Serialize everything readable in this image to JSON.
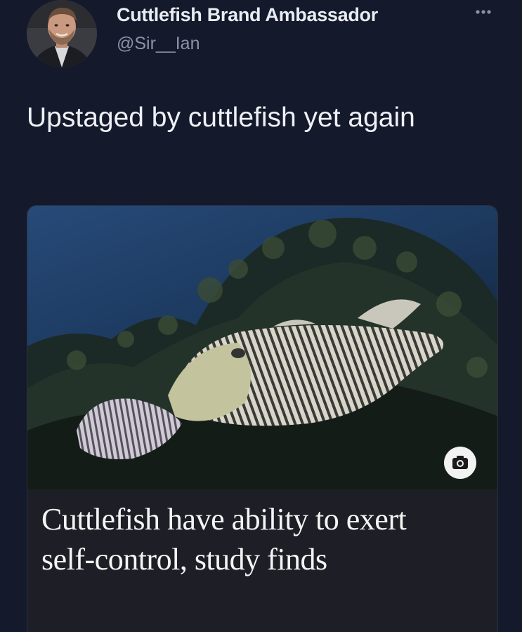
{
  "author": {
    "display_name": "Cuttlefish Brand Ambassador",
    "handle": "@Sir__Ian"
  },
  "more_icon": "more-horizontal-icon",
  "tweet": {
    "text": "Upstaged by cuttlefish yet again"
  },
  "card": {
    "camera_icon": "camera-icon",
    "headline": "Cuttlefish have ability to exert self-control, study finds"
  },
  "colors": {
    "background": "#141a2c",
    "name": "#e9ecf2",
    "handle": "#8a93a6",
    "card": "#1e1f26"
  }
}
